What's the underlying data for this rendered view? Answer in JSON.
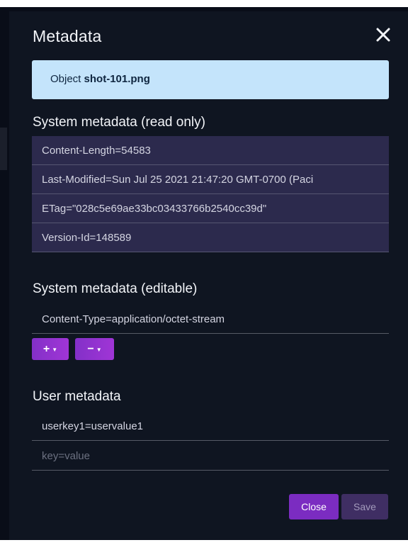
{
  "dialog": {
    "title": "Metadata",
    "close_icon": "close-icon"
  },
  "object": {
    "prefix": "Object",
    "name": "shot-101.png"
  },
  "system_readonly": {
    "title": "System metadata (read only)",
    "rows": [
      "Content-Length=54583",
      "Last-Modified=Sun Jul 25 2021 21:47:20 GMT-0700 (Paci",
      "ETag=\"028c5e69ae33bc03433766b2540cc39d\"",
      "Version-Id=148589"
    ]
  },
  "system_editable": {
    "title": "System metadata (editable)",
    "value": "Content-Type=application/octet-stream",
    "add_label": "+",
    "remove_label": "−",
    "dropdown_icon": "caret-down-icon"
  },
  "user_metadata": {
    "title": "User metadata",
    "value": "userkey1=uservalue1",
    "placeholder": "key=value"
  },
  "footer": {
    "close_label": "Close",
    "save_label": "Save"
  },
  "colors": {
    "accent": "#7b2cc1",
    "info_box": "#c4e4fb",
    "readonly_bg": "#2c2a4d",
    "modal_bg": "#0f1521"
  }
}
